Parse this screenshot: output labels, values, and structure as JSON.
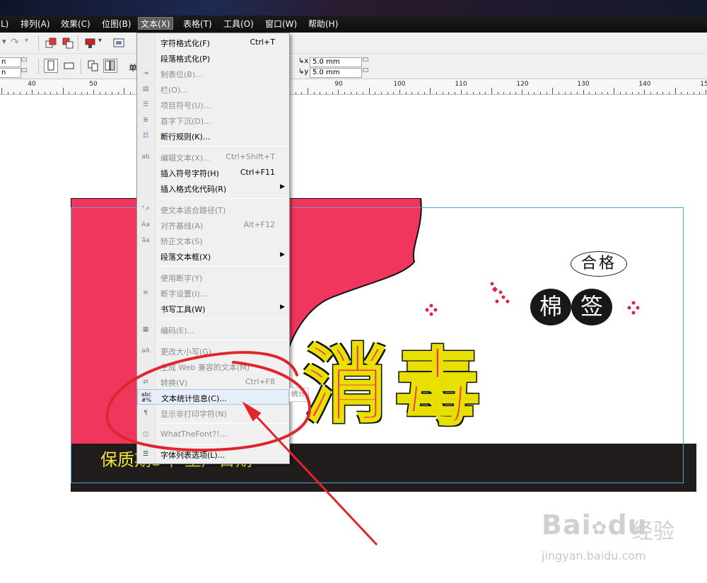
{
  "menubar": {
    "items": [
      {
        "label": "L)"
      },
      {
        "label": "排列(A)"
      },
      {
        "label": "效果(C)"
      },
      {
        "label": "位图(B)"
      },
      {
        "label": "文本(X)",
        "active": true
      },
      {
        "label": "表格(T)"
      },
      {
        "label": "工具(O)"
      },
      {
        "label": "窗口(W)"
      },
      {
        "label": "帮助(H)"
      }
    ]
  },
  "toolbar": {
    "row2_label_fragment": "单",
    "offset_x": "5.0 mm",
    "offset_y": "5.0 mm",
    "left_field_1": "n",
    "left_field_2": "n"
  },
  "ruler": {
    "labels": [
      "40",
      "50",
      "90",
      "100",
      "110",
      "120",
      "130",
      "140",
      "15"
    ]
  },
  "text_menu": {
    "items": [
      {
        "label": "字符格式化(F)",
        "shortcut": "Ctrl+T",
        "enabled": true,
        "icon": ""
      },
      {
        "label": "段落格式化(P)",
        "shortcut": "",
        "enabled": true,
        "icon": ""
      },
      {
        "label": "制表位(B)...",
        "shortcut": "",
        "enabled": false,
        "icon": "tab-icon"
      },
      {
        "label": "栏(O)...",
        "shortcut": "",
        "enabled": false,
        "icon": "columns-icon"
      },
      {
        "label": "项目符号(U)...",
        "shortcut": "",
        "enabled": false,
        "icon": "bullets-icon"
      },
      {
        "label": "首字下沉(D)...",
        "shortcut": "",
        "enabled": false,
        "icon": "drop-cap-icon"
      },
      {
        "label": "断行规则(K)...",
        "shortcut": "",
        "enabled": true,
        "icon": "line-break-icon"
      },
      {
        "label": "编辑文本(X)...",
        "shortcut": "Ctrl+Shift+T",
        "enabled": false,
        "icon": "edit-text-icon"
      },
      {
        "label": "插入符号字符(H)",
        "shortcut": "Ctrl+F11",
        "enabled": true,
        "icon": ""
      },
      {
        "label": "插入格式化代码(R)",
        "shortcut": "",
        "enabled": true,
        "submenu": true,
        "icon": ""
      },
      {
        "label": "使文本适合路径(T)",
        "shortcut": "",
        "enabled": false,
        "icon": "fit-path-icon"
      },
      {
        "label": "对齐基线(A)",
        "shortcut": "Alt+F12",
        "enabled": false,
        "icon": "align-baseline-icon"
      },
      {
        "label": "矫正文本(S)",
        "shortcut": "",
        "enabled": false,
        "icon": "straighten-text-icon"
      },
      {
        "label": "段落文本框(X)",
        "shortcut": "",
        "enabled": true,
        "submenu": true,
        "icon": ""
      },
      {
        "label": "使用断字(Y)",
        "shortcut": "",
        "enabled": false,
        "icon": ""
      },
      {
        "label": "断字设置(I)...",
        "shortcut": "",
        "enabled": false,
        "icon": "hyphenation-icon"
      },
      {
        "label": "书写工具(W)",
        "shortcut": "",
        "enabled": true,
        "submenu": true,
        "icon": ""
      },
      {
        "label": "编码(E)...",
        "shortcut": "",
        "enabled": false,
        "icon": "encoding-icon"
      },
      {
        "label": "更改大小写(G)...",
        "shortcut": "",
        "enabled": false,
        "icon": "change-case-icon"
      },
      {
        "label": "生成 Web 兼容的文本(M)",
        "shortcut": "",
        "enabled": false,
        "icon": ""
      },
      {
        "label": "转换(V)",
        "shortcut": "Ctrl+F8",
        "enabled": false,
        "icon": "convert-icon"
      },
      {
        "label": "文本统计信息(C)...",
        "shortcut": "",
        "enabled": true,
        "highlighted": true,
        "icon": "text-statistics-icon"
      },
      {
        "label": "显示非打印字符(N)",
        "shortcut": "",
        "enabled": false,
        "icon": "pilcrow-icon"
      },
      {
        "label": "WhatTheFont?!...",
        "shortcut": "",
        "enabled": false,
        "icon": "whatthefont-icon"
      },
      {
        "label": "字体列表选项(L)...",
        "shortcut": "",
        "enabled": true,
        "icon": "font-list-icon"
      }
    ]
  },
  "tooltip": {
    "text": "统计"
  },
  "design": {
    "qualified": "合格",
    "mian": "棉",
    "qian": "签",
    "xiao": "消",
    "du": "毒",
    "shelf_life": "保质期3年  生产日期"
  },
  "watermark": {
    "brand": "Bai",
    "brand2": "du",
    "cn": "经验",
    "url": "jingyan.baidu.com"
  },
  "colors": {
    "pink": "#f0365c",
    "yellow": "#e8e000",
    "menu_bg": "#f0f0f0",
    "highlight": "#e6eef9"
  }
}
